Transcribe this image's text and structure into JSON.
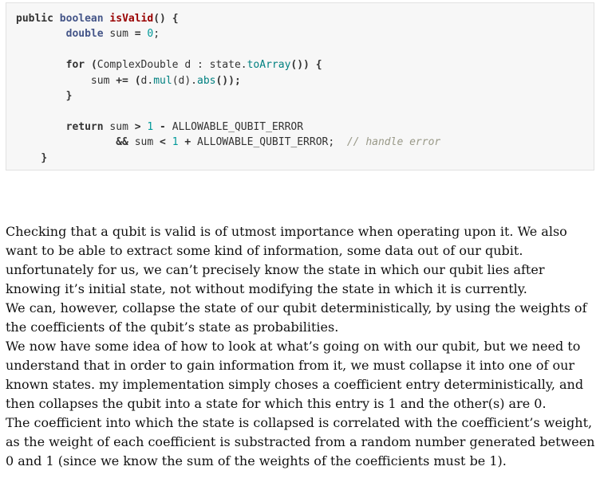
{
  "code": {
    "line1": {
      "kw1": "public",
      "typ": "boolean",
      "fn": "isValid",
      "rest": "() {"
    },
    "line2": {
      "indent": "        ",
      "typ": "double",
      "plain": " sum ",
      "op": "=",
      "sp": " ",
      "num": "0",
      "end": ";"
    },
    "line3": {
      "text": ""
    },
    "line4": {
      "indent": "        ",
      "kw": "for",
      "sp": " ",
      "open": "(",
      "plain1": "ComplexDouble d : state.",
      "mth": "toArray",
      "close": "()) {"
    },
    "line5": {
      "indent": "            ",
      "plain1": "sum ",
      "op": "+=",
      "plain2": " ",
      "open": "(",
      "plain3": "d.",
      "mth1": "mul",
      "mid": "(d).",
      "mth2": "abs",
      "close": "());"
    },
    "line6": {
      "indent": "        ",
      "brace": "}"
    },
    "line7": {
      "text": ""
    },
    "line8": {
      "indent": "        ",
      "kw": "return",
      "plain1": " sum ",
      "op1": ">",
      "sp": " ",
      "num": "1",
      "sp2": " ",
      "op2": "-",
      "plain2": " ALLOWABLE_QUBIT_ERROR"
    },
    "line9": {
      "indent": "                ",
      "op1": "&&",
      "plain1": " sum ",
      "op2": "<",
      "sp": " ",
      "num": "1",
      "sp2": " ",
      "op3": "+",
      "plain2": " ALLOWABLE_QUBIT_ERROR;  ",
      "cmt": "// handle error"
    },
    "line10": {
      "indent": "    ",
      "brace": "}"
    }
  },
  "prose": {
    "p1": "Checking that a qubit is valid is of utmost importance when operating upon it. We also want to be able to extract some kind of information, some data out of our qubit. unfortunately for us, we can’t precisely know the state in which our qubit lies after knowing it’s initial state, not without modifying the state in which it is currently.",
    "p2": "We can, however, collapse the state of our qubit deterministically, by using the weights of the coefficients of the qubit’s state as probabilities.",
    "p3": "We now have some idea of how to look at what’s going on with our qubit, but we need to understand that in order to gain information from it, we must collapse it into one of our known states. my implementation simply choses a coefficient entry deterministically, and then collapses the qubit into a state for which this entry is 1 and the other(s) are 0.",
    "p4": "The coefficient into which the state is collapsed is correlated with the coefficient’s weight, as the weight of each coefficient is substracted from a random number generated between 0 and 1 (since we know the sum of the weights of the coefficients must be 1)."
  }
}
